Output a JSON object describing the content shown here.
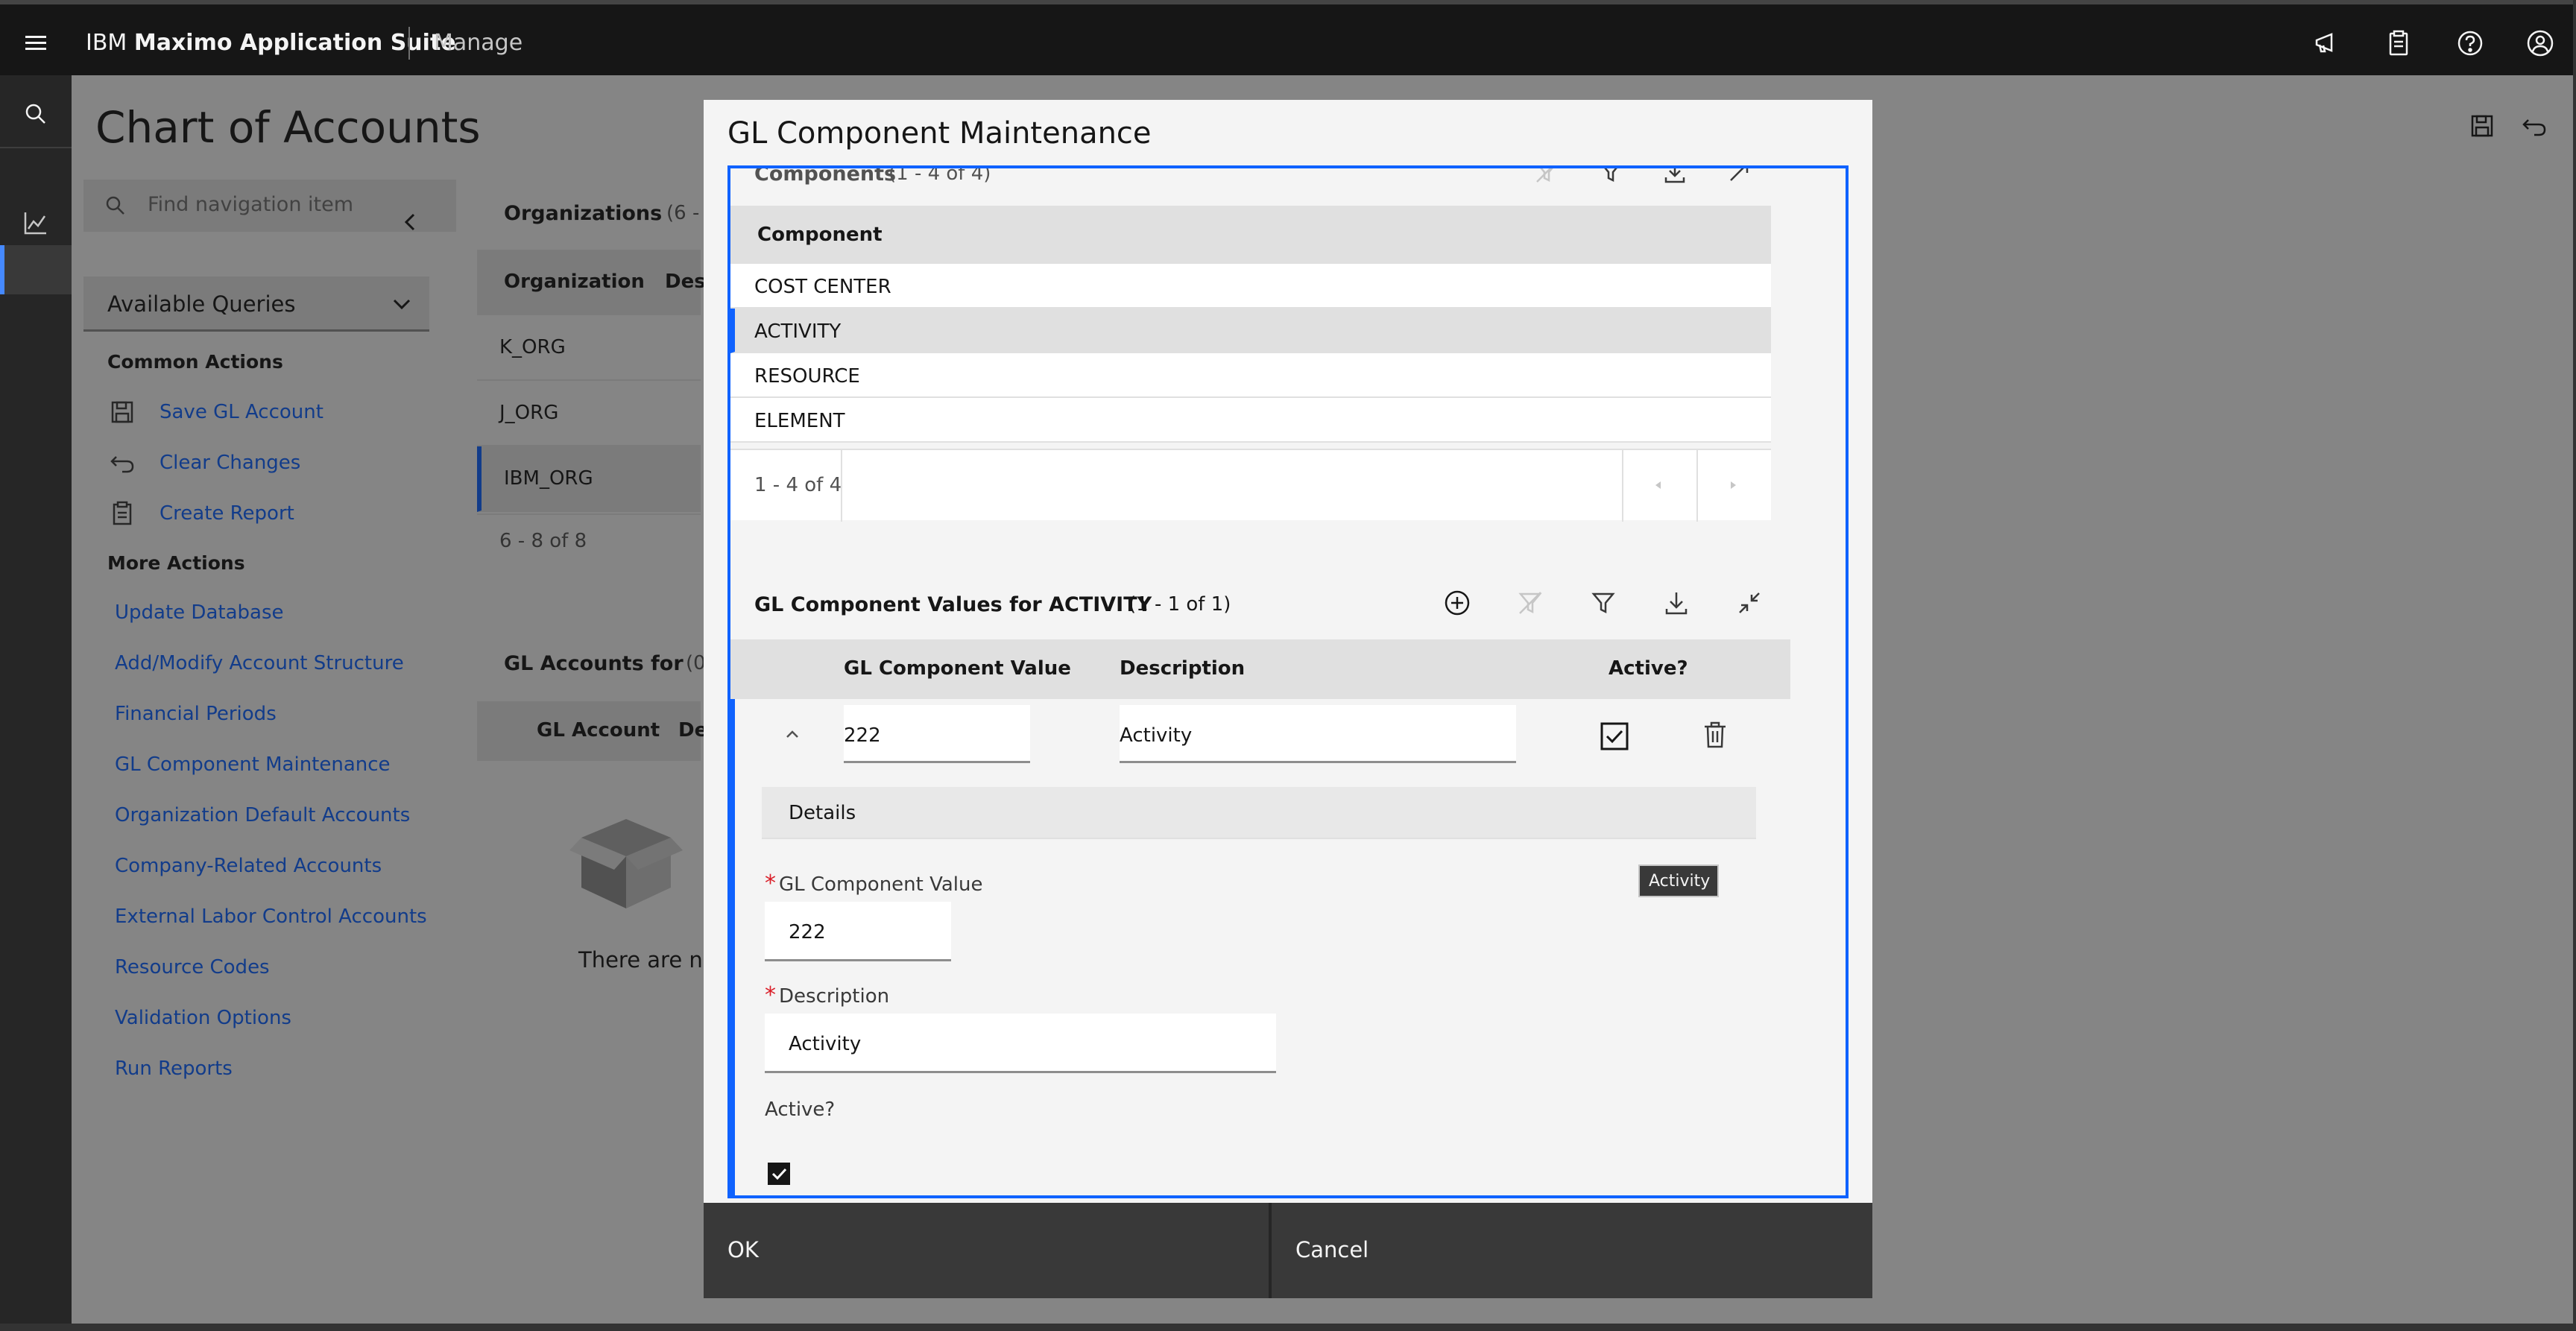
{
  "header": {
    "brand_prefix": "IBM",
    "brand_name": "Maximo Application Suite",
    "app_name": "Manage",
    "icons": [
      "hamburger-icon",
      "announcement-icon",
      "clipboard-icon",
      "help-icon",
      "user-icon"
    ]
  },
  "page": {
    "title": "Chart of Accounts"
  },
  "sidenav": {
    "search_placeholder": "Find navigation item",
    "queries_label": "Available Queries",
    "common_title": "Common Actions",
    "common_actions": [
      {
        "label": "Save GL Account",
        "icon": "save-icon"
      },
      {
        "label": "Clear Changes",
        "icon": "undo-icon"
      },
      {
        "label": "Create Report",
        "icon": "report-icon"
      }
    ],
    "more_title": "More Actions",
    "more_actions": [
      "Update Database",
      "Add/Modify Account Structure",
      "Financial Periods",
      "GL Component Maintenance",
      "Organization Default Accounts",
      "Company-Related Accounts",
      "External Labor Control Accounts",
      "Resource Codes",
      "Validation Options",
      "Run Reports"
    ]
  },
  "organizations": {
    "title": "Organizations",
    "count": "(6 -",
    "col_org": "Organization",
    "col_desc": "Des",
    "rows": [
      "K_ORG",
      "J_ORG",
      "IBM_ORG"
    ],
    "selected": "IBM_ORG",
    "pagination": "6 - 8 of 8"
  },
  "gl_accounts": {
    "title": "GL Accounts for",
    "count": "(0",
    "col_account": "GL Account",
    "col_desc": "Des",
    "empty_text": "There are no"
  },
  "modal": {
    "title": "GL Component Maintenance",
    "components": {
      "title": "Components",
      "count": "(1 - 4 of 4)",
      "column": "Component",
      "rows": [
        "COST CENTER",
        "ACTIVITY",
        "RESOURCE",
        "ELEMENT"
      ],
      "selected": "ACTIVITY",
      "pagination": "1 - 4 of 4"
    },
    "values": {
      "title": "GL Component Values for ACTIVITY",
      "count": "(1 - 1 of 1)",
      "col_value": "GL Component Value",
      "col_desc": "Description",
      "col_active": "Active?",
      "row": {
        "value": "222",
        "description": "Activity",
        "active": true
      }
    },
    "details": {
      "title": "Details",
      "value_label": "GL Component Value",
      "value": "222",
      "desc_label": "Description",
      "desc": "Activity",
      "active_label": "Active?",
      "active": true,
      "tooltip": "Activity"
    },
    "ok_label": "OK",
    "cancel_label": "Cancel"
  },
  "colors": {
    "accent": "#0f62fe",
    "header_bg": "#161616",
    "link": "#0f62fe",
    "required": "#da1e28"
  }
}
